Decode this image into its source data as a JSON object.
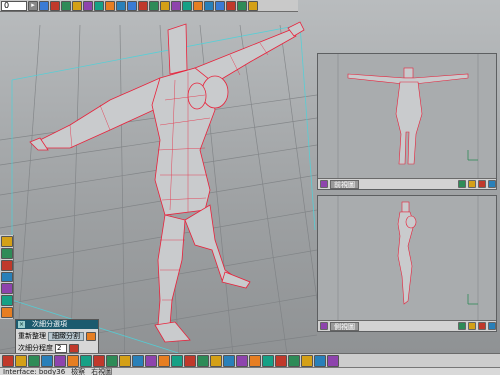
{
  "app": {
    "viewport_name": "perspective-viewport"
  },
  "top_toolbar": {
    "frame_value": "0",
    "frame_marker": "▸",
    "buttons": [
      {
        "name": "playback-controls-icon",
        "color": "#3a7bd5"
      },
      {
        "name": "record-icon",
        "color": "#c0392b"
      },
      {
        "name": "keyframe-icon",
        "color": "#2e8b57"
      },
      {
        "name": "camera-icon",
        "color": "#d4a017"
      },
      {
        "name": "render-icon",
        "color": "#8e44ad"
      },
      {
        "name": "lights-icon",
        "color": "#16a085"
      },
      {
        "name": "materials-icon",
        "color": "#e67e22"
      },
      {
        "name": "shapes-icon",
        "color": "#2980b9"
      }
    ]
  },
  "front_view": {
    "label": "前視圖",
    "label_color": "#8e44ad"
  },
  "side_view": {
    "label": "側視圖",
    "label_color": "#8e44ad"
  },
  "subdivision_panel": {
    "title": "次細分選項",
    "row1_label": "重新整理",
    "row1_button": "細緻分割",
    "row2_label": "次細分程度",
    "row2_value": "2"
  },
  "left_dock": [
    {
      "name": "object-tool-icon",
      "color": "#d4a017"
    },
    {
      "name": "move-tool-icon",
      "color": "#2e8b57"
    },
    {
      "name": "rotate-tool-icon",
      "color": "#c0392b"
    },
    {
      "name": "scale-tool-icon",
      "color": "#2980b9"
    },
    {
      "name": "paint-tool-icon",
      "color": "#8e44ad"
    },
    {
      "name": "texture-tool-icon",
      "color": "#16a085"
    },
    {
      "name": "deform-tool-icon",
      "color": "#e67e22"
    }
  ],
  "bottom_toolbar": [
    {
      "name": "create-box-icon",
      "color": "#c0392b"
    },
    {
      "name": "create-sphere-icon",
      "color": "#d4a017"
    },
    {
      "name": "create-cylinder-icon",
      "color": "#2e8b57"
    },
    {
      "name": "create-cone-icon",
      "color": "#2980b9"
    },
    {
      "name": "create-torus-icon",
      "color": "#8e44ad"
    },
    {
      "name": "create-plane-icon",
      "color": "#e67e22"
    },
    {
      "name": "lathe-icon",
      "color": "#16a085"
    },
    {
      "name": "extrude-icon",
      "color": "#c0392b"
    },
    {
      "name": "boolean-icon",
      "color": "#2e8b57"
    },
    {
      "name": "mesh-edit-icon",
      "color": "#d4a017"
    },
    {
      "name": "subdivide-icon",
      "color": "#2980b9"
    },
    {
      "name": "smooth-icon",
      "color": "#8e44ad"
    },
    {
      "name": "select-icon",
      "color": "#e67e22"
    },
    {
      "name": "weld-icon",
      "color": "#16a085"
    },
    {
      "name": "bend-icon",
      "color": "#c0392b"
    },
    {
      "name": "twist-icon",
      "color": "#2e8b57"
    },
    {
      "name": "taper-icon",
      "color": "#d4a017"
    },
    {
      "name": "skin-icon",
      "color": "#2980b9"
    },
    {
      "name": "bones-icon",
      "color": "#8e44ad"
    },
    {
      "name": "animate-icon",
      "color": "#e67e22"
    },
    {
      "name": "grid-icon",
      "color": "#16a085"
    },
    {
      "name": "snap-icon",
      "color": "#c0392b"
    },
    {
      "name": "view-icon",
      "color": "#2e8b57"
    },
    {
      "name": "render-preview-icon",
      "color": "#d4a017"
    },
    {
      "name": "export-icon",
      "color": "#2980b9"
    },
    {
      "name": "settings-icon",
      "color": "#8e44ad"
    }
  ],
  "status_bar": {
    "interface_text": "Interface: body36",
    "mode_text": "檢察",
    "extra_text": "右視圖"
  },
  "colors": {
    "wire": "#e8223b",
    "mesh_fill": "#c9cbcd",
    "grid": "#7d8083",
    "axis_cyan": "#4fd1d9"
  }
}
